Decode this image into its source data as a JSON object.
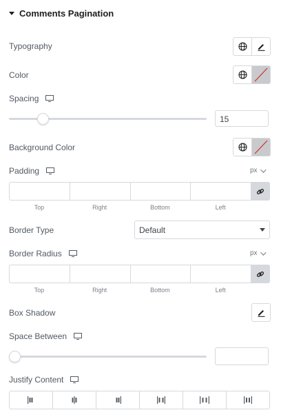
{
  "section": {
    "title": "Comments Pagination"
  },
  "typography": {
    "label": "Typography"
  },
  "color": {
    "label": "Color"
  },
  "spacing": {
    "label": "Spacing",
    "value": "15",
    "slider_fraction": 0.15
  },
  "background_color": {
    "label": "Background Color"
  },
  "padding": {
    "label": "Padding",
    "unit": "px",
    "top_label": "Top",
    "right_label": "Right",
    "bottom_label": "Bottom",
    "left_label": "Left"
  },
  "border_type": {
    "label": "Border Type",
    "value": "Default"
  },
  "border_radius": {
    "label": "Border Radius",
    "unit": "px",
    "top_label": "Top",
    "right_label": "Right",
    "bottom_label": "Bottom",
    "left_label": "Left"
  },
  "box_shadow": {
    "label": "Box Shadow"
  },
  "space_between": {
    "label": "Space Between",
    "value": "",
    "slider_fraction": 0.0
  },
  "justify_content": {
    "label": "Justify Content",
    "options": [
      "start",
      "center",
      "end",
      "space-between",
      "space-around",
      "space-evenly"
    ]
  }
}
